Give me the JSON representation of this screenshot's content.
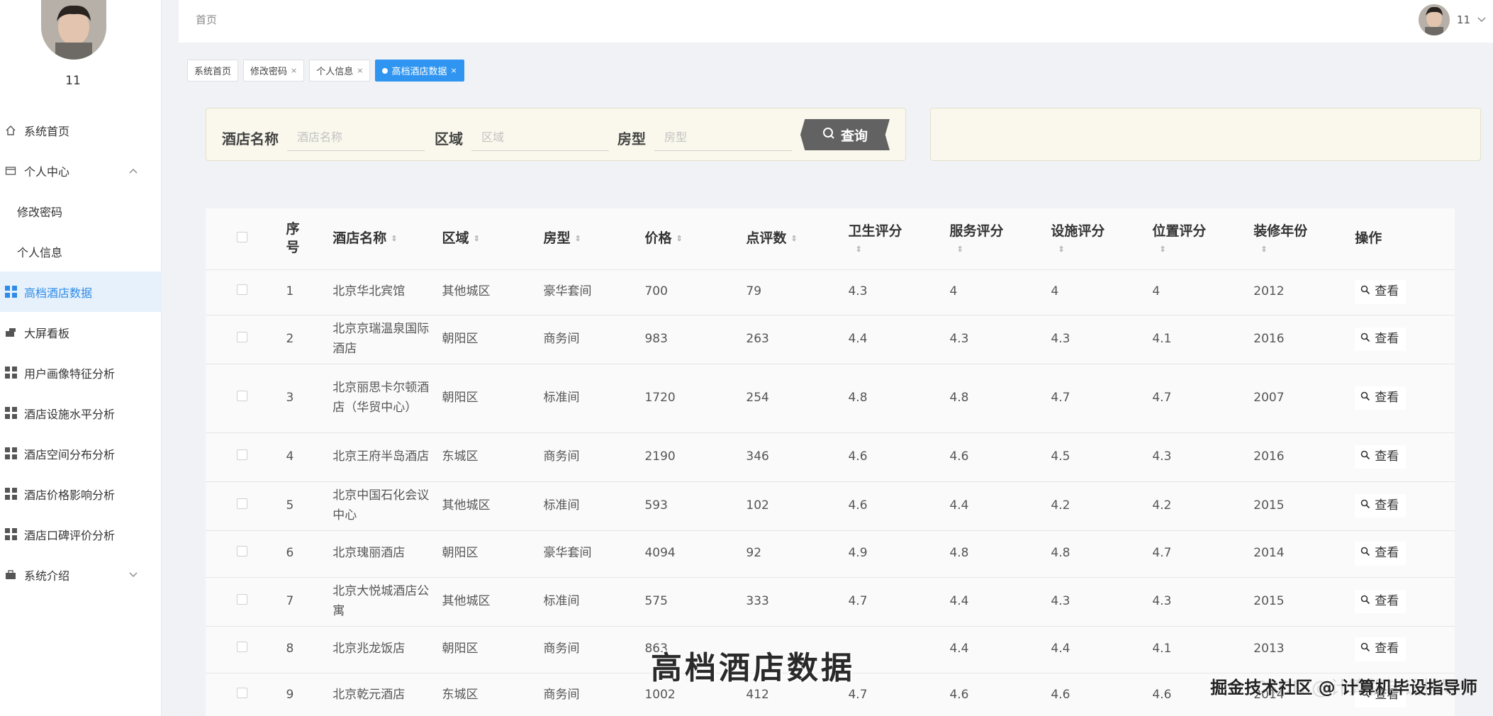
{
  "sidebar": {
    "username": "11",
    "items": [
      {
        "label": "系统首页",
        "icon": "home-icon",
        "sub": false,
        "active": false,
        "chevron": ""
      },
      {
        "label": "个人中心",
        "icon": "card-icon",
        "sub": false,
        "active": false,
        "chevron": "^"
      },
      {
        "label": "修改密码",
        "icon": "",
        "sub": true,
        "active": false,
        "chevron": ""
      },
      {
        "label": "个人信息",
        "icon": "",
        "sub": true,
        "active": false,
        "chevron": ""
      },
      {
        "label": "高档酒店数据",
        "icon": "grid-icon",
        "sub": false,
        "active": true,
        "chevron": ""
      },
      {
        "label": "大屏看板",
        "icon": "board-icon",
        "sub": false,
        "active": false,
        "chevron": ""
      },
      {
        "label": "用户画像特征分析",
        "icon": "grid-icon",
        "sub": false,
        "active": false,
        "chevron": ""
      },
      {
        "label": "酒店设施水平分析",
        "icon": "grid-icon",
        "sub": false,
        "active": false,
        "chevron": ""
      },
      {
        "label": "酒店空间分布分析",
        "icon": "grid-icon",
        "sub": false,
        "active": false,
        "chevron": ""
      },
      {
        "label": "酒店价格影响分析",
        "icon": "grid-icon",
        "sub": false,
        "active": false,
        "chevron": ""
      },
      {
        "label": "酒店口碑评价分析",
        "icon": "grid-icon",
        "sub": false,
        "active": false,
        "chevron": ""
      },
      {
        "label": "系统介绍",
        "icon": "briefcase-icon",
        "sub": false,
        "active": false,
        "chevron": "v"
      }
    ]
  },
  "header": {
    "breadcrumb": "首页",
    "username": "11",
    "chevron": "v"
  },
  "tabs": [
    {
      "label": "系统首页",
      "closable": false,
      "active": false
    },
    {
      "label": "修改密码",
      "closable": true,
      "active": false
    },
    {
      "label": "个人信息",
      "closable": true,
      "active": false
    },
    {
      "label": "高档酒店数据",
      "closable": true,
      "active": true
    }
  ],
  "tab_close_glyph": "×",
  "search": {
    "name_label": "酒店名称",
    "name_placeholder": "酒店名称",
    "name_value": "",
    "area_label": "区域",
    "area_placeholder": "区域",
    "area_value": "",
    "room_label": "房型",
    "room_placeholder": "房型",
    "room_value": "",
    "button_label": "查询"
  },
  "table": {
    "columns": [
      {
        "key": "no",
        "label": "序号",
        "sortable": false
      },
      {
        "key": "name",
        "label": "酒店名称",
        "sortable": true
      },
      {
        "key": "area",
        "label": "区域",
        "sortable": true
      },
      {
        "key": "room",
        "label": "房型",
        "sortable": true
      },
      {
        "key": "price",
        "label": "价格",
        "sortable": true
      },
      {
        "key": "reviews",
        "label": "点评数",
        "sortable": true
      },
      {
        "key": "hygiene",
        "label": "卫生评分",
        "sortable": true
      },
      {
        "key": "service",
        "label": "服务评分",
        "sortable": true
      },
      {
        "key": "facility",
        "label": "设施评分",
        "sortable": true
      },
      {
        "key": "location",
        "label": "位置评分",
        "sortable": true
      },
      {
        "key": "year",
        "label": "装修年份",
        "sortable": true
      },
      {
        "key": "action",
        "label": "操作",
        "sortable": false
      }
    ],
    "action_label": "查看",
    "sort_glyph": "⇕",
    "rows": [
      {
        "no": "1",
        "name": "北京华北宾馆",
        "area": "其他城区",
        "room": "豪华套间",
        "price": "700",
        "reviews": "79",
        "hygiene": "4.3",
        "service": "4",
        "facility": "4",
        "location": "4",
        "year": "2012"
      },
      {
        "no": "2",
        "name": "北京京瑞温泉国际酒店",
        "area": "朝阳区",
        "room": "商务间",
        "price": "983",
        "reviews": "263",
        "hygiene": "4.4",
        "service": "4.3",
        "facility": "4.3",
        "location": "4.1",
        "year": "2016"
      },
      {
        "no": "3",
        "name": "北京丽思卡尔顿酒店（华贸中心）",
        "area": "朝阳区",
        "room": "标准间",
        "price": "1720",
        "reviews": "254",
        "hygiene": "4.8",
        "service": "4.8",
        "facility": "4.7",
        "location": "4.7",
        "year": "2007"
      },
      {
        "no": "4",
        "name": "北京王府半岛酒店",
        "area": "东城区",
        "room": "商务间",
        "price": "2190",
        "reviews": "346",
        "hygiene": "4.6",
        "service": "4.6",
        "facility": "4.5",
        "location": "4.3",
        "year": "2016"
      },
      {
        "no": "5",
        "name": "北京中国石化会议中心",
        "area": "其他城区",
        "room": "标准间",
        "price": "593",
        "reviews": "102",
        "hygiene": "4.6",
        "service": "4.4",
        "facility": "4.2",
        "location": "4.2",
        "year": "2015"
      },
      {
        "no": "6",
        "name": "北京瑰丽酒店",
        "area": "朝阳区",
        "room": "豪华套间",
        "price": "4094",
        "reviews": "92",
        "hygiene": "4.9",
        "service": "4.8",
        "facility": "4.8",
        "location": "4.7",
        "year": "2014"
      },
      {
        "no": "7",
        "name": "北京大悦城酒店公寓",
        "area": "其他城区",
        "room": "标准间",
        "price": "575",
        "reviews": "333",
        "hygiene": "4.7",
        "service": "4.4",
        "facility": "4.3",
        "location": "4.3",
        "year": "2015"
      },
      {
        "no": "8",
        "name": "北京兆龙饭店",
        "area": "朝阳区",
        "room": "商务间",
        "price": "863",
        "reviews": "",
        "hygiene": "",
        "service": "4.4",
        "facility": "4.4",
        "location": "4.1",
        "year": "2013"
      },
      {
        "no": "9",
        "name": "北京乾元酒店",
        "area": "东城区",
        "room": "商务间",
        "price": "1002",
        "reviews": "412",
        "hygiene": "4.7",
        "service": "4.6",
        "facility": "4.6",
        "location": "4.6",
        "year": "2014"
      }
    ]
  },
  "overlay": {
    "caption": "高档酒店数据",
    "watermark_faint": "CSDN @计算机毕设指导师",
    "watermark_bold": "掘金技术社区 @ 计算机毕设指导师"
  }
}
